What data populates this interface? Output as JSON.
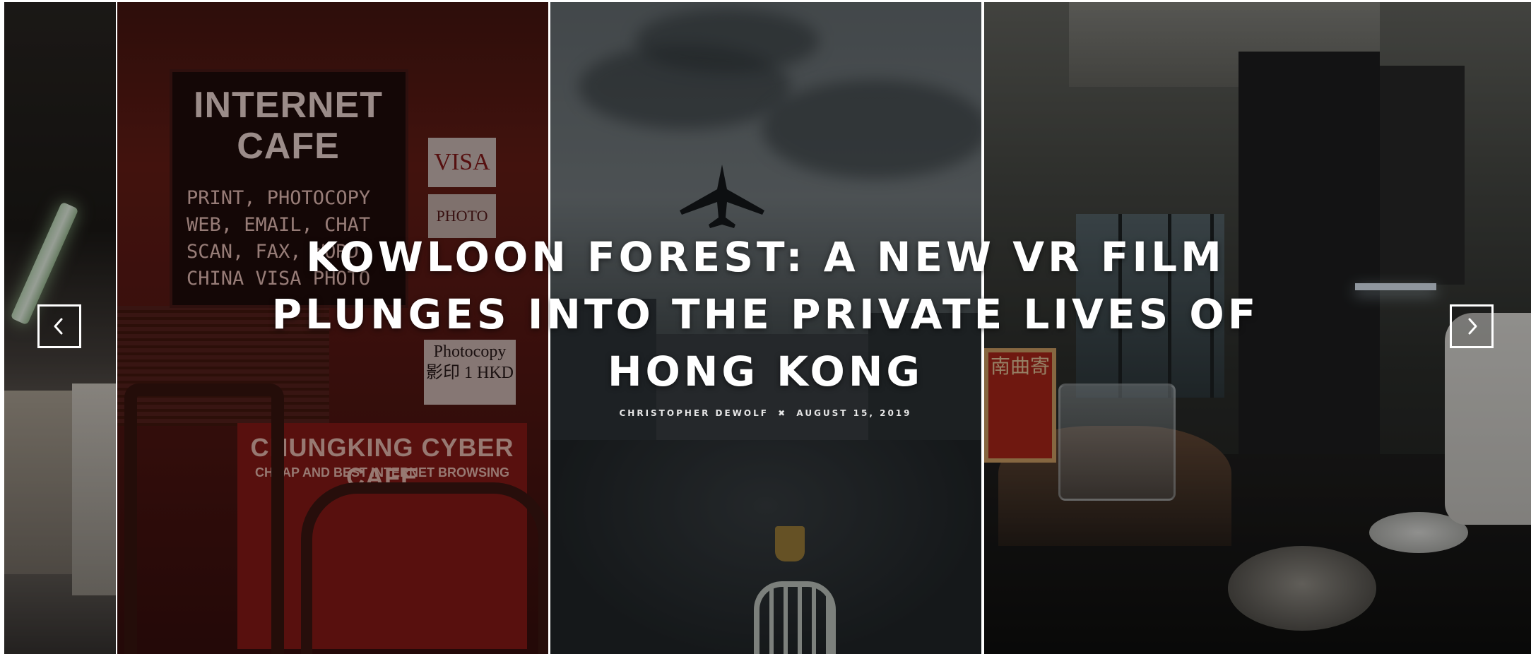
{
  "slide": {
    "title": "KOWLOON FOREST: A NEW VR FILM PLUNGES INTO THE PRIVATE LIVES OF HONG KONG",
    "author": "CHRISTOPHER DEWOLF",
    "separator": "✖",
    "date": "AUGUST 15, 2019"
  },
  "images": {
    "cafe_sign": {
      "heading": "INTERNET CAFE",
      "lines": [
        "PRINT, PHOTOCOPY",
        "WEB, EMAIL, CHAT",
        "SCAN, FAX, WORD",
        "CHINA VISA PHOTO"
      ]
    },
    "visa_label": "VISA",
    "photo_label": "PHOTO",
    "photocopy_label": "Photocopy 影印 1 HKD",
    "cyber_cafe_title": "CHUNGKING CYBER CAFE",
    "cyber_cafe_subtitle": "CHEAP AND BEST INTERNET BROWSING",
    "red_sign_text": "南曲寄"
  },
  "controls": {
    "prev_icon": "chevron-left-icon",
    "next_icon": "chevron-right-icon"
  },
  "colors": {
    "text": "#ffffff",
    "arrow_border": "#ffffff"
  }
}
